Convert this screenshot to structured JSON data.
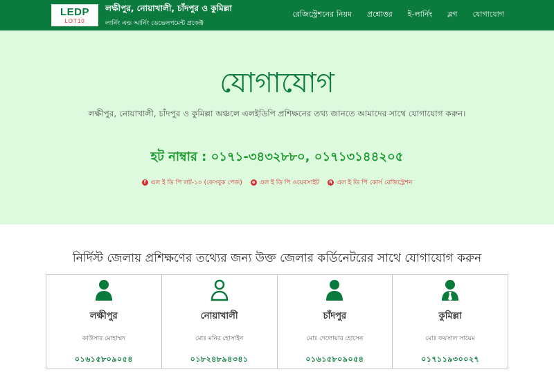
{
  "header": {
    "logo_main": "LEDP",
    "logo_sub": "LOT10",
    "title": "লক্ষীপুর, নোয়াখালী, চাঁদপুর ও কুমিল্লা",
    "subtitle": "লার্নিং এন্ড আর্নিং ডেভেলপমেন্ট প্রজেক্ট",
    "nav": [
      {
        "label": "রেজিস্ট্রেশনের নিয়ম"
      },
      {
        "label": "প্রশ্নোত্তর"
      },
      {
        "label": "ই-লার্নিং"
      },
      {
        "label": "ব্লগ"
      },
      {
        "label": "যোগাযোগ"
      }
    ]
  },
  "hero": {
    "title": "যোগাযোগ",
    "description": "লক্ষীপুর, নোয়াখালী, চাঁদপুর ও কুমিল্লা অঞ্চলে এলইডিপি প্রশিক্ষনের তথ্য জানতে আমাদের সাথে যোগাযোগ করুন।",
    "hotline": "হট নাম্বার : ০১৭১-৩৪৩২৮৮০, ০১৭১৩১৪৪২০৫",
    "links": [
      {
        "icon": "facebook-icon",
        "glyph": "f",
        "label": "এল ই ডি পি লট-১০ (ফেসবুক পেজ)"
      },
      {
        "icon": "globe-icon",
        "glyph": "⊕",
        "label": "এল ই ডি পি ওয়েবসাইট"
      },
      {
        "icon": "registration-icon",
        "glyph": "R",
        "label": "এল ই ডি পি কোর্স রেজিস্ট্রেশন"
      }
    ]
  },
  "section": {
    "title": "নির্দিস্ট জেলায় প্রশিক্ষণের তথ্যের জন্য উক্ত জেলার কর্ডিনেটরের সাথে যোগাযোগ করুন"
  },
  "cards": [
    {
      "district": "লক্ষীপুর",
      "name": "কাউসার মোহাম্মদ",
      "phone": "০১৬১৫৮০৯০৫৪",
      "icon": "person-solid"
    },
    {
      "district": "নোয়াখালী",
      "name": "মোঃ মনির হোসাইন",
      "phone": "০১৮২৪৮৯৪৩৪১",
      "icon": "person-outline"
    },
    {
      "district": "চাঁদপুর",
      "name": "মোঃ দেলোয়ার হোসেন",
      "phone": "০১৬১৫৮০৯০৫৪",
      "icon": "person-solid"
    },
    {
      "district": "কুমিল্লা",
      "name": "মোঃ ফয়সাল সায়েম",
      "phone": "০১৭১১৯৩০০২৭",
      "icon": "person-solid"
    }
  ],
  "colors": {
    "primary_green": "#0a7a3d",
    "hero_bg": "#defade",
    "hotline_green": "#1a9a2e",
    "link_red": "#d32f2f"
  }
}
